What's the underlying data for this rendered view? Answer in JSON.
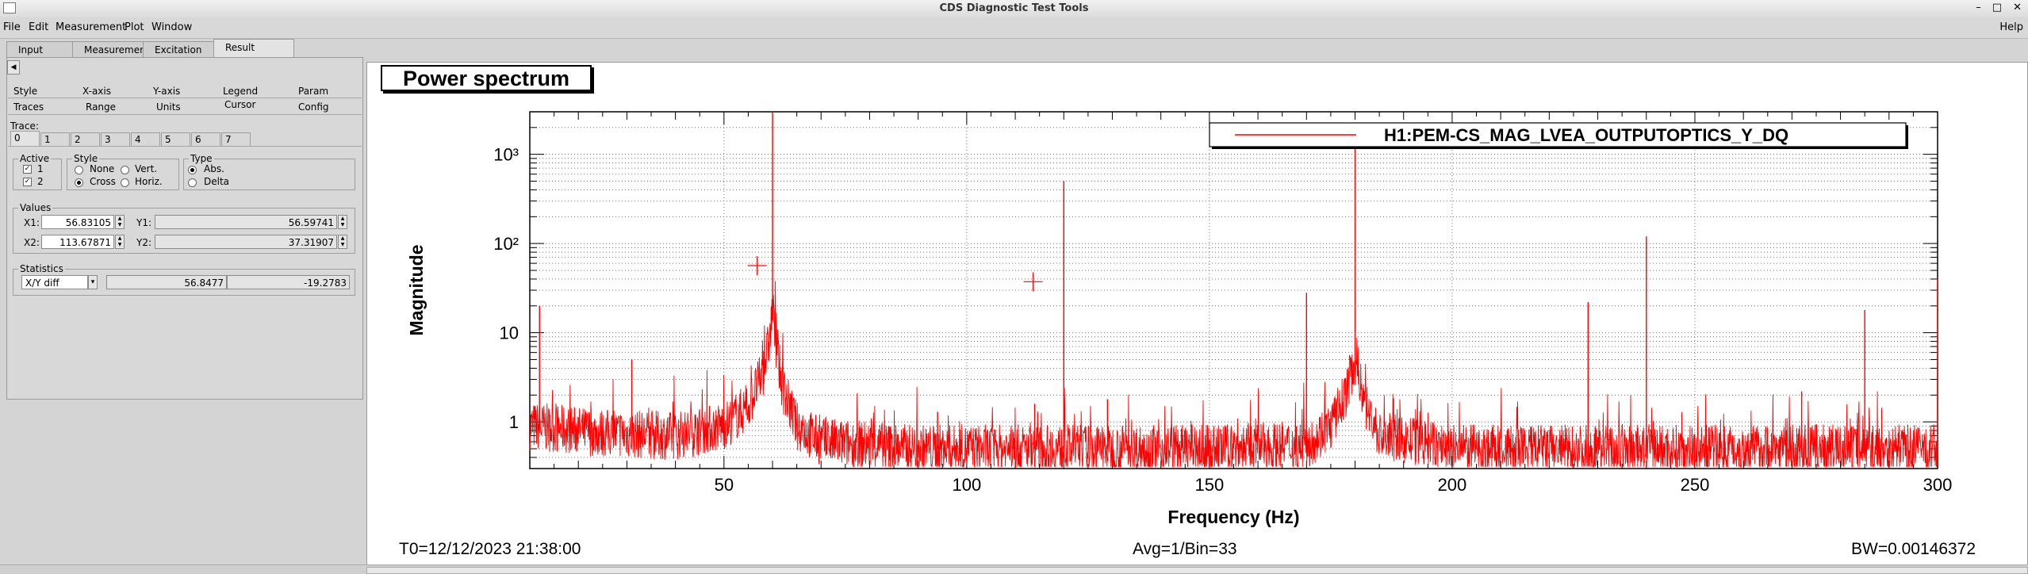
{
  "window": {
    "title": "CDS Diagnostic Test Tools",
    "buttons": [
      "–",
      "□",
      "✕"
    ]
  },
  "menubar": {
    "items": [
      "File",
      "Edit",
      "Measurement",
      "Plot",
      "Window"
    ],
    "help": "Help"
  },
  "main_tabs": [
    "Input",
    "Measurement",
    "Excitation",
    "Result"
  ],
  "main_tab_active": "Result",
  "panel": {
    "collapse_glyph": "◀",
    "tabs_row1": [
      "Style",
      "X-axis",
      "Y-axis",
      "Legend",
      "Param"
    ],
    "tabs_row2": [
      "Traces",
      "Range",
      "Units",
      "Cursor",
      "Config"
    ],
    "active_tab": "Cursor",
    "trace_label": "Trace:",
    "trace_tabs": [
      "0",
      "1",
      "2",
      "3",
      "4",
      "5",
      "6",
      "7"
    ],
    "active_group": {
      "title": "Active",
      "items": [
        {
          "label": "1",
          "checked": true
        },
        {
          "label": "2",
          "checked": true
        }
      ]
    },
    "style_group": {
      "title": "Style",
      "options": [
        "None",
        "Vert.",
        "Cross",
        "Horiz."
      ],
      "selected": "Cross"
    },
    "type_group": {
      "title": "Type",
      "options": [
        "Abs.",
        "Delta"
      ],
      "selected": "Abs."
    },
    "values_group": {
      "title": "Values",
      "x1_label": "X1:",
      "x1": "56.83105",
      "y1_label": "Y1:",
      "y1": "56.59741",
      "x2_label": "X2:",
      "x2": "113.67871",
      "y2_label": "Y2:",
      "y2": "37.31907"
    },
    "stats_group": {
      "title": "Statistics",
      "mode": "X/Y diff",
      "dx": "56.8477",
      "dy": "-19.2783"
    }
  },
  "plot": {
    "title": "Power spectrum",
    "legend": "H1:PEM-CS_MAG_LVEA_OUTPUTOPTICS_Y_DQ",
    "footer_left": "T0=12/12/2023 21:38:00",
    "footer_mid": "Avg=1/Bin=33",
    "footer_right": "BW=0.00146372"
  },
  "colors": {
    "trace": "#ff0000",
    "window_bg": "#d4d4d4",
    "plot_bg": "#ffffff"
  },
  "chart_data": {
    "type": "line",
    "title": "Power spectrum",
    "xlabel": "Frequency (Hz)",
    "ylabel": "Magnitude",
    "xlim": [
      10,
      300
    ],
    "ylim": [
      0.3,
      3000
    ],
    "y_scale": "log",
    "x_ticks": [
      50,
      100,
      150,
      200,
      250,
      300
    ],
    "x_tick_labels": [
      "50",
      "100",
      "150",
      "200",
      "250",
      "300"
    ],
    "y_ticks": [
      1,
      10,
      100,
      1000
    ],
    "y_tick_labels": [
      "1",
      "10",
      "10²",
      "10³"
    ],
    "grid": true,
    "legend_position": "top-right",
    "series": [
      {
        "name": "H1:PEM-CS_MAG_LVEA_OUTPUTOPTICS_Y_DQ",
        "baseline": [
          [
            10,
            0.9
          ],
          [
            25,
            0.75
          ],
          [
            40,
            0.7
          ],
          [
            50,
            0.9
          ],
          [
            55,
            1.5
          ],
          [
            58,
            3.5
          ],
          [
            59.5,
            9
          ],
          [
            60,
            20
          ],
          [
            60.5,
            9
          ],
          [
            62,
            2.5
          ],
          [
            65,
            0.9
          ],
          [
            70,
            0.6
          ],
          [
            90,
            0.5
          ],
          [
            120,
            0.5
          ],
          [
            150,
            0.5
          ],
          [
            170,
            0.55
          ],
          [
            175,
            0.9
          ],
          [
            178,
            2
          ],
          [
            179.7,
            4.5
          ],
          [
            180.3,
            4.5
          ],
          [
            182,
            1.6
          ],
          [
            185,
            0.7
          ],
          [
            200,
            0.5
          ],
          [
            250,
            0.5
          ],
          [
            300,
            0.5
          ]
        ],
        "peaks": [
          [
            12,
            20
          ],
          [
            31,
            5
          ],
          [
            60,
            3000
          ],
          [
            94,
            1.3
          ],
          [
            114,
            1.6
          ],
          [
            120,
            500
          ],
          [
            129,
            1.8
          ],
          [
            170,
            28
          ],
          [
            180,
            1200
          ],
          [
            228,
            22
          ],
          [
            240,
            120
          ],
          [
            272,
            2.2
          ],
          [
            285,
            18
          ],
          [
            300,
            40
          ]
        ]
      }
    ],
    "cursors": [
      {
        "x": 56.83105,
        "y": 56.59741
      },
      {
        "x": 113.67871,
        "y": 37.31907
      }
    ]
  }
}
